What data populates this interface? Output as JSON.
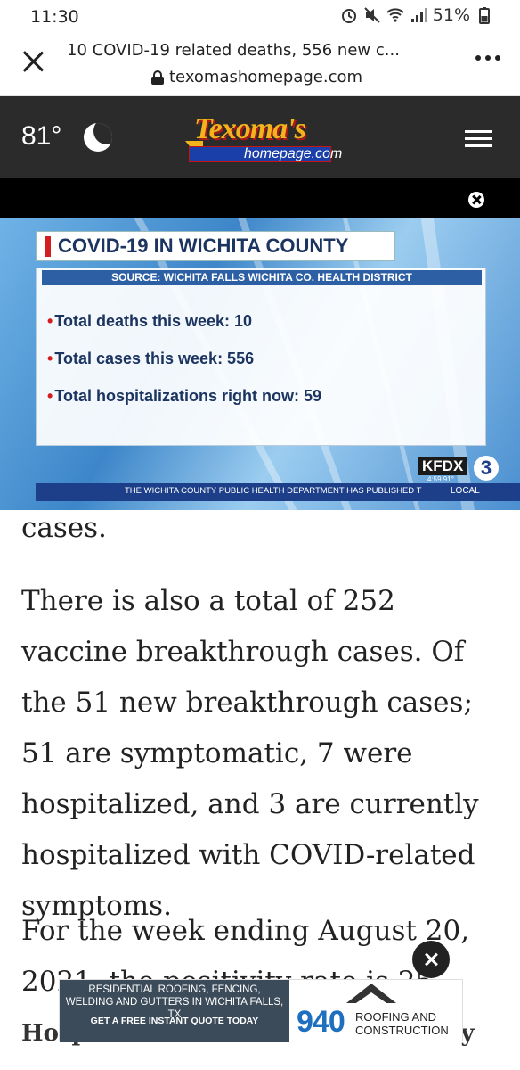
{
  "status": {
    "time": "11:30",
    "battery": "51%"
  },
  "browser": {
    "title": "10 COVID-19 related deaths, 556 new c...",
    "url": "texomashomepage.com"
  },
  "header": {
    "temperature": "81°",
    "weather_icon": "moon-icon",
    "logo_top": "Texoma's",
    "logo_bottom": "homepage.com"
  },
  "video": {
    "graphic_title": "COVID-19 IN WICHITA COUNTY",
    "source": "SOURCE: WICHITA FALLS WICHITA CO. HEALTH DISTRICT",
    "lines": [
      "Total deaths this week: 10",
      "Total cases this week: 556",
      "Total hospitalizations right now: 59"
    ],
    "ticker": "THE WICHITA COUNTY PUBLIC HEALTH DEPARTMENT HAS PUBLISHED T",
    "ticker_tag": "LOCAL",
    "station": "KFDX",
    "station_num": "3",
    "station_time": "4:59  91°"
  },
  "article": {
    "fragment": "cases.",
    "paragraph1": "There is also a total of 252 vaccine breakthrough cases. Of the 51 new breakthrough cases; 51 are symptomatic, 7 were hospitalized, and 3 are currently hospitalized with COVID-related symptoms.",
    "paragraph2": "For the week ending August 20, 2021, the positivity rate is 25",
    "subheading": "Hospitalizations in Wichita County"
  },
  "ad": {
    "line1": "RESIDENTIAL ROOFING, FENCING, WELDING AND GUTTERS IN WICHITA FALLS, TX",
    "cta": "GET A FREE INSTANT QUOTE TODAY",
    "number": "940",
    "brand": "ROOFING AND CONSTRUCTION"
  }
}
